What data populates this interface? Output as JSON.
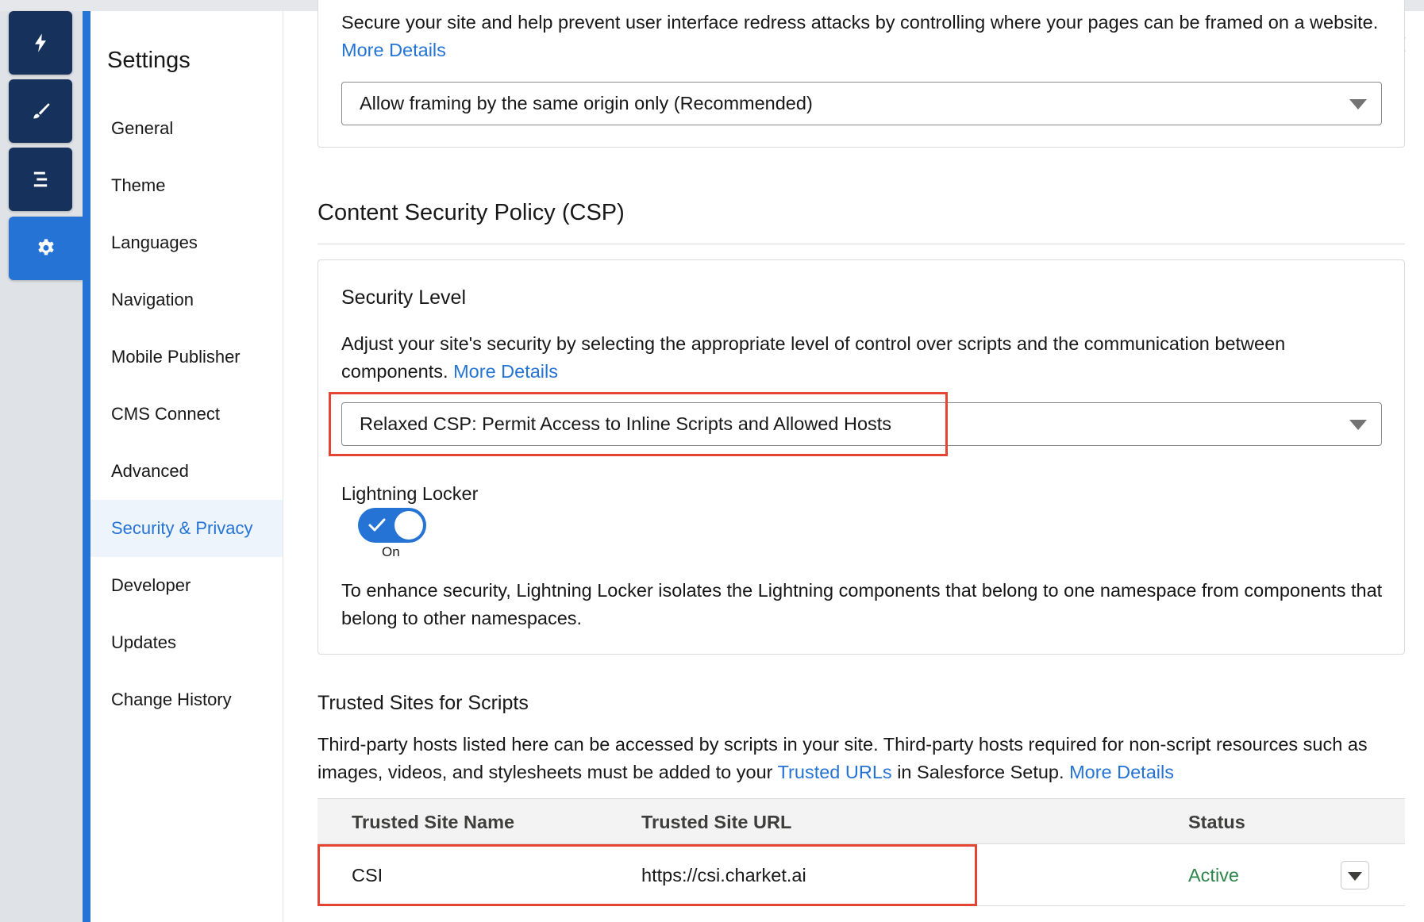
{
  "rail": {
    "icons": [
      "lightning-icon",
      "brush-icon",
      "menu-lines-icon",
      "gear-icon"
    ]
  },
  "settings": {
    "title": "Settings",
    "nav": [
      {
        "label": "General"
      },
      {
        "label": "Theme"
      },
      {
        "label": "Languages"
      },
      {
        "label": "Navigation"
      },
      {
        "label": "Mobile Publisher"
      },
      {
        "label": "CMS Connect"
      },
      {
        "label": "Advanced"
      },
      {
        "label": "Security & Privacy",
        "selected": true
      },
      {
        "label": "Developer"
      },
      {
        "label": "Updates"
      },
      {
        "label": "Change History"
      }
    ]
  },
  "clickjack": {
    "description": "Secure your site and help prevent user interface redress attacks by controlling where your pages can be framed on a website.",
    "more_details": "More Details",
    "select_value": "Allow framing by the same origin only (Recommended)"
  },
  "csp": {
    "heading": "Content Security Policy (CSP)",
    "security_level_title": "Security Level",
    "description": "Adjust your site's security by selecting the appropriate level of control over scripts and the communication between components.",
    "more_details": "More Details",
    "select_value": "Relaxed CSP: Permit Access to Inline Scripts and Allowed Hosts",
    "locker_label": "Lightning Locker",
    "toggle_state": "On",
    "locker_description": "To enhance security, Lightning Locker isolates the Lightning components that belong to one namespace from components that belong to other namespaces."
  },
  "trusted_sites": {
    "heading": "Trusted Sites for Scripts",
    "description_part1": "Third-party hosts listed here can be accessed by scripts in your site. Third-party hosts required for non-script resources such as images, videos, and stylesheets must be added to your",
    "trusted_urls_link": "Trusted URLs",
    "description_part2": "in Salesforce Setup.",
    "more_details": "More Details",
    "columns": [
      "Trusted Site Name",
      "Trusted Site URL",
      "Status"
    ],
    "rows": [
      {
        "name": "CSI",
        "url": "https://csi.charket.ai",
        "status": "Active"
      }
    ]
  },
  "colors": {
    "brand_blue": "#2574d5",
    "rail_dark": "#16325c",
    "status_active": "#2e844a",
    "highlight_red": "#e44533"
  }
}
